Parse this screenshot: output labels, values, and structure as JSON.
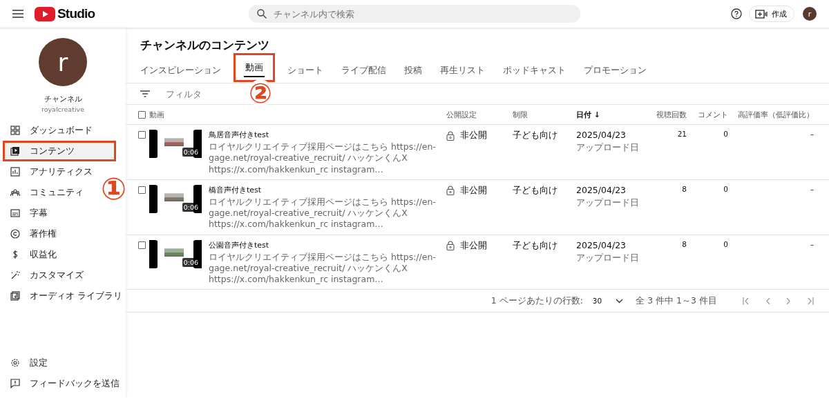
{
  "header": {
    "logo_text": "Studio",
    "search": {
      "placeholder": "チャンネル内で検索"
    },
    "create_label": "作成",
    "avatar_letter": "r"
  },
  "sidebar": {
    "avatar_letter": "r",
    "channel_name": "チャンネル",
    "handle": "royalcreative",
    "items": [
      {
        "label": "ダッシュボード",
        "selected": false,
        "highlighted": false
      },
      {
        "label": "コンテンツ",
        "selected": true,
        "highlighted": true
      },
      {
        "label": "アナリティクス",
        "selected": false,
        "highlighted": false
      },
      {
        "label": "コミュニティ",
        "selected": false,
        "highlighted": false
      },
      {
        "label": "字幕",
        "selected": false,
        "highlighted": false
      },
      {
        "label": "著作権",
        "selected": false,
        "highlighted": false
      },
      {
        "label": "収益化",
        "selected": false,
        "highlighted": false
      },
      {
        "label": "カスタマイズ",
        "selected": false,
        "highlighted": false
      },
      {
        "label": "オーディオ ライブラリ",
        "selected": false,
        "highlighted": false
      }
    ],
    "bottom_items": [
      {
        "label": "設定"
      },
      {
        "label": "フィードバックを送信"
      }
    ]
  },
  "page_title": "チャンネルのコンテンツ",
  "tabs": [
    {
      "label": "インスピレーション",
      "selected": false,
      "highlighted": false
    },
    {
      "label": "動画",
      "selected": true,
      "highlighted": true
    },
    {
      "label": "ショート",
      "selected": false,
      "highlighted": false
    },
    {
      "label": "ライブ配信",
      "selected": false,
      "highlighted": false
    },
    {
      "label": "投稿",
      "selected": false,
      "highlighted": false
    },
    {
      "label": "再生リスト",
      "selected": false,
      "highlighted": false
    },
    {
      "label": "ポッドキャスト",
      "selected": false,
      "highlighted": false
    },
    {
      "label": "プロモーション",
      "selected": false,
      "highlighted": false
    }
  ],
  "filter": {
    "placeholder": "フィルタ"
  },
  "annotations": [
    {
      "label": "①"
    },
    {
      "label": "②"
    }
  ],
  "table": {
    "header_checked": false,
    "columns": [
      "動画",
      "公開設定",
      "制限",
      "日付 ↓",
      "視聴回数",
      "コメント",
      "高評価率（低評価比）"
    ],
    "rows": [
      {
        "checked": false,
        "duration": "0:06",
        "title": "鳥居音声付きtest",
        "description": "ロイヤルクリエイティブ採用ページはこちら https://en-gage.net/royal-creative_recruit/ ハッケンくんX https://x.com/hakkenkun_rc instagram…",
        "visibility": "非公開",
        "restriction": "子ども向け",
        "date": "2025/04/23",
        "date_note": "アップロード日",
        "views": "21",
        "comments": "0",
        "likes": "–"
      },
      {
        "checked": false,
        "duration": "0:06",
        "title": "橋音声付きtest",
        "description": "ロイヤルクリエイティブ採用ページはこちら https://en-gage.net/royal-creative_recruit/ ハッケンくんX https://x.com/hakkenkun_rc instagram…",
        "visibility": "非公開",
        "restriction": "子ども向け",
        "date": "2025/04/23",
        "date_note": "アップロード日",
        "views": "8",
        "comments": "0",
        "likes": "–"
      },
      {
        "checked": false,
        "duration": "0:06",
        "title": "公園音声付きtest",
        "description": "ロイヤルクリエイティブ採用ページはこちら https://en-gage.net/royal-creative_recruit/ ハッケンくんX https://x.com/hakkenkun_rc instagram…",
        "visibility": "非公開",
        "restriction": "子ども向け",
        "date": "2025/04/23",
        "date_note": "アップロード日",
        "views": "8",
        "comments": "0",
        "likes": "–"
      }
    ]
  },
  "pagination": {
    "rows_per_page_label": "1 ページあたりの行数:",
    "rows_per_page": "30",
    "range": "全 3 件中 1～3 件目"
  }
}
